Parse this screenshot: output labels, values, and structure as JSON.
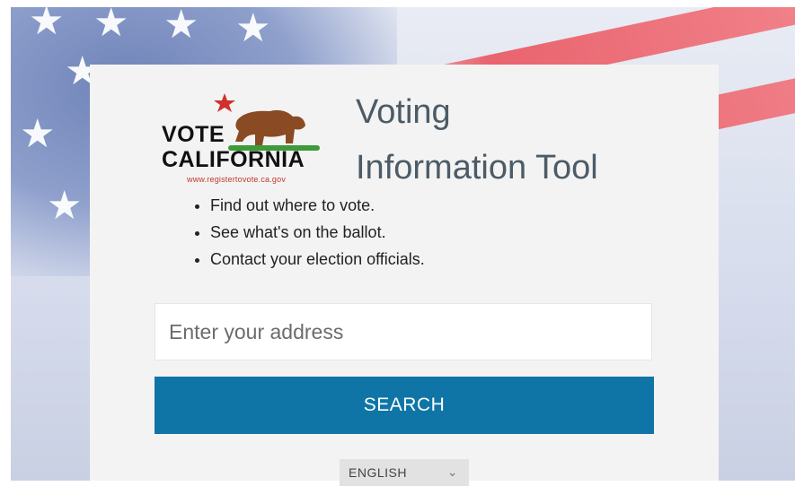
{
  "logo": {
    "line1": "VOTE",
    "line2": "CALIFORNIA",
    "url": "www.registertovote.ca.gov"
  },
  "title": {
    "line1": "Voting",
    "line2": "Information Tool"
  },
  "bullets": [
    "Find out where to vote.",
    "See what's on the ballot.",
    "Contact your election officials."
  ],
  "search": {
    "placeholder": "Enter your address",
    "button_label": "SEARCH"
  },
  "language": {
    "selected": "ENGLISH",
    "icon": "chevron-down-icon"
  },
  "colors": {
    "button": "#0f75a6",
    "title_text": "#4c5b66",
    "card": "#f3f3f3",
    "logo_bear": "#8a4a24",
    "logo_grass": "#3e9b3a",
    "logo_star": "#d0312d"
  }
}
